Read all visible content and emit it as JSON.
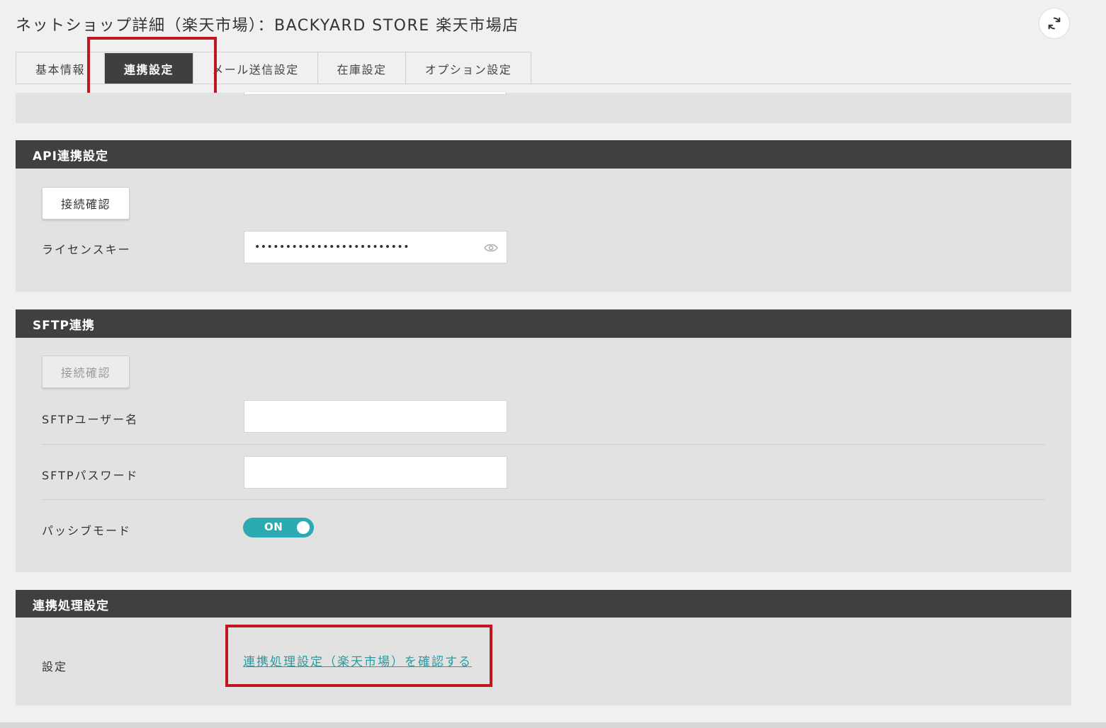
{
  "header": {
    "title": "ネットショップ詳細（楽天市場）：BACKYARD STORE 楽天市場店",
    "refresh_icon": "refresh-icon"
  },
  "tabs": [
    {
      "label": "基本情報",
      "active": false
    },
    {
      "label": "連携設定",
      "active": true
    },
    {
      "label": "メール送信設定",
      "active": false
    },
    {
      "label": "在庫設定",
      "active": false
    },
    {
      "label": "オプション設定",
      "active": false
    }
  ],
  "api_section": {
    "title": "API連携設定",
    "check_button": "接続確認",
    "license_key_label": "ライセンスキー",
    "license_key_value": "•••••••••••••••••••••••••",
    "eye_icon": "eye-icon"
  },
  "sftp_section": {
    "title": "SFTP連携",
    "check_button": "接続確認",
    "username_label": "SFTPユーザー名",
    "username_value": "",
    "password_label": "SFTPパスワード",
    "password_value": "",
    "passive_label": "パッシブモード",
    "passive_toggle": "ON"
  },
  "process_section": {
    "title": "連携処理設定",
    "setting_label": "設定",
    "link_text": "連携処理設定（楽天市場）を確認する"
  },
  "colors": {
    "header_bg": "#404040",
    "section_bg": "#e2e2e2",
    "accent_teal": "#2baab1",
    "link": "#2a9aa1",
    "highlight_red": "#c0161f"
  }
}
